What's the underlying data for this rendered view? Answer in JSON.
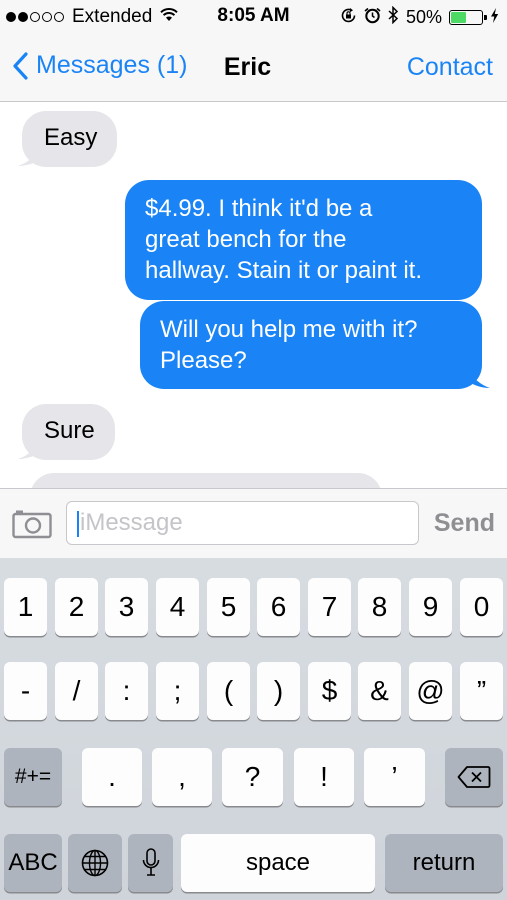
{
  "status_bar": {
    "carrier": "Extended",
    "time": "8:05 AM",
    "battery_percent": "50%",
    "battery_level": 0.5,
    "signal_dots_filled": 2,
    "signal_dots_total": 5,
    "icons": [
      "wifi-icon",
      "rotation-lock-icon",
      "alarm-icon",
      "bluetooth-icon",
      "battery-icon",
      "charging-bolt-icon"
    ]
  },
  "nav": {
    "back_label": "Messages (1)",
    "title": "Eric",
    "contact_label": "Contact"
  },
  "messages": [
    {
      "direction": "incoming",
      "text": "Easy"
    },
    {
      "direction": "outgoing",
      "lines": [
        "$4.99. I think it'd be a",
        "great bench for the",
        "hallway. Stain it or paint it."
      ]
    },
    {
      "direction": "outgoing",
      "lines": [
        "Will you help me with it?",
        "Please?"
      ]
    },
    {
      "direction": "incoming",
      "text": "Sure"
    }
  ],
  "input": {
    "placeholder": "iMessage",
    "value": "",
    "send_label": "Send"
  },
  "keyboard": {
    "row1": [
      "1",
      "2",
      "3",
      "4",
      "5",
      "6",
      "7",
      "8",
      "9",
      "0"
    ],
    "row2": [
      "-",
      "/",
      ":",
      ";",
      "(",
      ")",
      "$",
      "&",
      "@",
      "”"
    ],
    "row3_toggle": "#+=",
    "row3": [
      ".",
      ",",
      "?",
      "!",
      "’"
    ],
    "bottom": {
      "abc": "ABC",
      "space": "space",
      "return": "return"
    }
  },
  "colors": {
    "accent": "#1a84f6",
    "incoming_bubble": "#e5e5ea",
    "outgoing_bubble": "#1a84f6",
    "battery_fill": "#4cd964"
  }
}
